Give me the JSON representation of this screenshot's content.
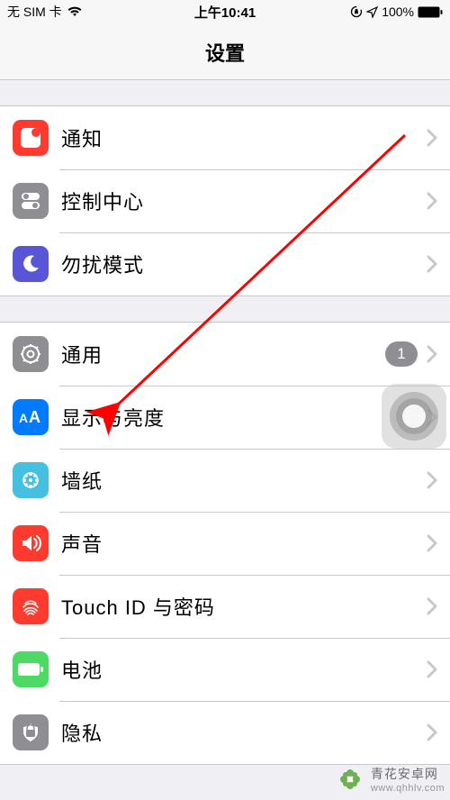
{
  "status": {
    "carrier": "无 SIM 卡",
    "time": "上午10:41",
    "battery_pct": "100%"
  },
  "header": {
    "title": "设置"
  },
  "groups": [
    {
      "rows": [
        {
          "label": "通知",
          "icon": "notifications-icon",
          "bg": "bg-red"
        },
        {
          "label": "控制中心",
          "icon": "control-center-icon",
          "bg": "bg-grey"
        },
        {
          "label": "勿扰模式",
          "icon": "dnd-icon",
          "bg": "bg-purple"
        }
      ]
    },
    {
      "rows": [
        {
          "label": "通用",
          "icon": "general-icon",
          "bg": "bg-grey",
          "badge": "1"
        },
        {
          "label": "显示与亮度",
          "icon": "display-icon",
          "bg": "bg-blue"
        },
        {
          "label": "墙纸",
          "icon": "wallpaper-icon",
          "bg": "bg-cyan"
        },
        {
          "label": "声音",
          "icon": "sounds-icon",
          "bg": "bg-red"
        },
        {
          "label": "Touch ID 与密码",
          "icon": "touchid-icon",
          "bg": "bg-red"
        },
        {
          "label": "电池",
          "icon": "battery-icon",
          "bg": "bg-green"
        },
        {
          "label": "隐私",
          "icon": "privacy-icon",
          "bg": "bg-grey2"
        }
      ]
    }
  ],
  "watermark": {
    "line1": "青花安卓网",
    "line2": "www.qhhlv.com"
  }
}
